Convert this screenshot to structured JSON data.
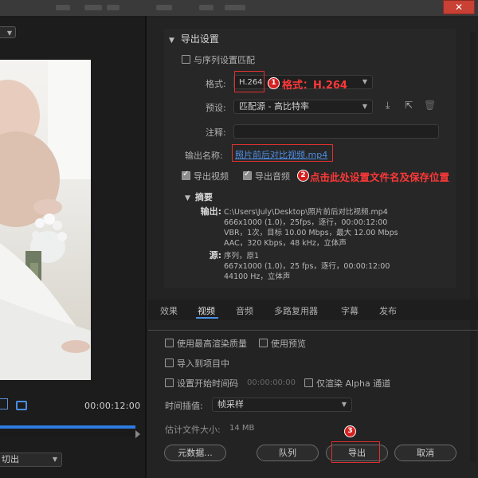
{
  "window": {
    "close_glyph": "✕"
  },
  "preview": {
    "timecode": "00:00:12:00",
    "crop_mode": "切出"
  },
  "export_settings": {
    "section_title": "导出设置",
    "match_sequence_label": "与序列设置匹配",
    "format_label": "格式:",
    "format_value": "H.264",
    "preset_label": "预设:",
    "preset_value": "匹配源 - 高比特率",
    "comments_label": "注释:",
    "comments_value": "",
    "output_name_label": "输出名称:",
    "output_name_value": "照片前后对比视频.mp4",
    "export_video_label": "导出视频",
    "export_audio_label": "导出音频"
  },
  "annotations": {
    "a1_num": "1",
    "a1_text": "格式：H.264",
    "a2_num": "2",
    "a2_text": "点击此处设置文件名及保存位置",
    "a3_num": "3"
  },
  "summary": {
    "title": "摘要",
    "output_key": "输出:",
    "output_lines": [
      "C:\\Users\\July\\Desktop\\照片前后对比视频.mp4",
      "666x1000 (1.0)，25fps，逐行，00:00:12:00",
      "VBR，1次，目标 10.00 Mbps，最大 12.00 Mbps",
      "AAC，320 Kbps，48 kHz，立体声"
    ],
    "source_key": "源:",
    "source_lines": [
      "序列，原1",
      "667x1000 (1.0)，25 fps，逐行，00:00:12:00",
      "44100 Hz，立体声"
    ]
  },
  "tabs": [
    "效果",
    "视频",
    "音频",
    "多路复用器",
    "字幕",
    "发布"
  ],
  "active_tab": "视频",
  "options": {
    "max_render_quality": "使用最高渲染质量",
    "use_previews": "使用预览",
    "import_into_project": "导入到项目中",
    "set_start_timecode": "设置开始时间码",
    "start_timecode_value": "00:00:00:00",
    "render_alpha_only": "仅渲染 Alpha 通道",
    "time_interpolation_label": "时间插值:",
    "time_interpolation_value": "帧采样",
    "estimated_size_label": "估计文件大小:",
    "estimated_size_value": "14 MB"
  },
  "buttons": {
    "metadata": "元数据...",
    "queue": "队列",
    "export": "导出",
    "cancel": "取消"
  },
  "colors": {
    "accent_blue": "#4a8ee0",
    "annotation_red": "#e03030"
  }
}
